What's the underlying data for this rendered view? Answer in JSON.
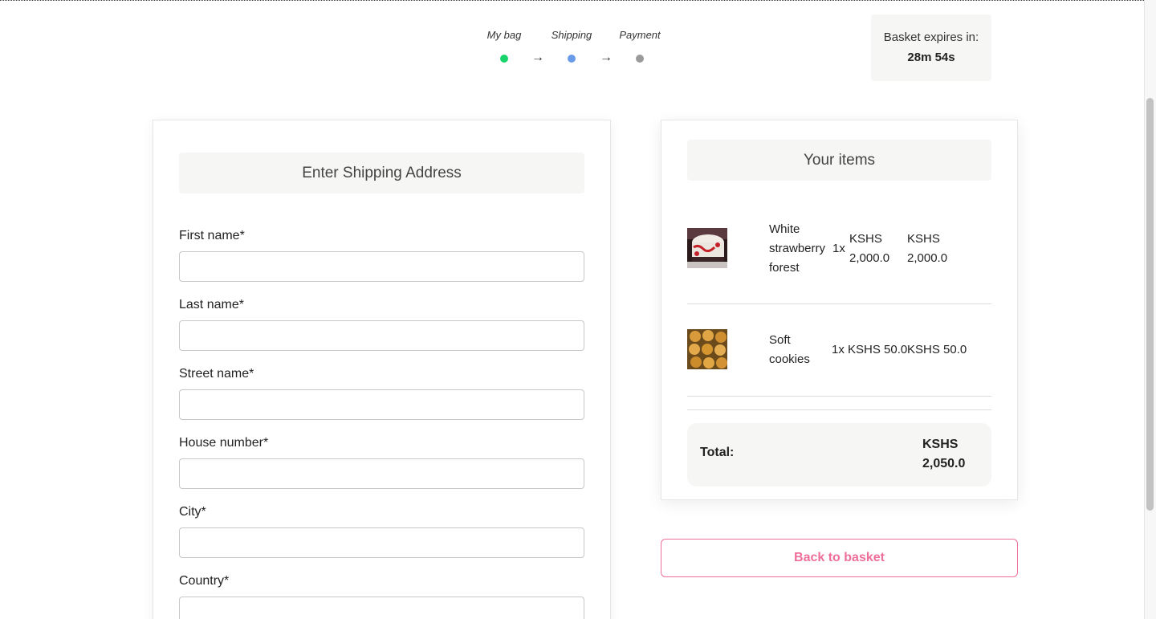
{
  "checkout_steps": [
    {
      "label": "My bag",
      "color": "#19d46a"
    },
    {
      "label": "Shipping",
      "color": "#6a9be8"
    },
    {
      "label": "Payment",
      "color": "#9a9a9a"
    }
  ],
  "arrow_glyph": "→",
  "basket_expiry": {
    "label": "Basket expires in:",
    "time": "28m 54s"
  },
  "shipping_form": {
    "title": "Enter Shipping Address",
    "fields": [
      {
        "label": "First name*",
        "value": ""
      },
      {
        "label": "Last name*",
        "value": ""
      },
      {
        "label": "Street name*",
        "value": ""
      },
      {
        "label": "House number*",
        "value": ""
      },
      {
        "label": "City*",
        "value": ""
      },
      {
        "label": "Country*",
        "value": ""
      }
    ]
  },
  "cart": {
    "title": "Your items",
    "items": [
      {
        "name_lines": [
          "White",
          "strawberry",
          "forest"
        ],
        "qty": "1x",
        "price_lines": [
          "KSHS",
          "2,000.0"
        ],
        "total_lines": [
          "KSHS",
          "2,000.0"
        ],
        "thumb": "cake-photo"
      },
      {
        "name_lines": [
          "Soft",
          "cookies"
        ],
        "qty": "1x",
        "price": "KSHS 50.0",
        "total": "KSHS 50.0",
        "thumb": "cookies-photo"
      }
    ],
    "total_label": "Total:",
    "total_value_lines": [
      "KSHS",
      "2,050.0"
    ]
  },
  "back_button": "Back to basket",
  "colors": {
    "accent_pink": "#ee6f9a",
    "panel_bg": "#f6f6f4"
  }
}
